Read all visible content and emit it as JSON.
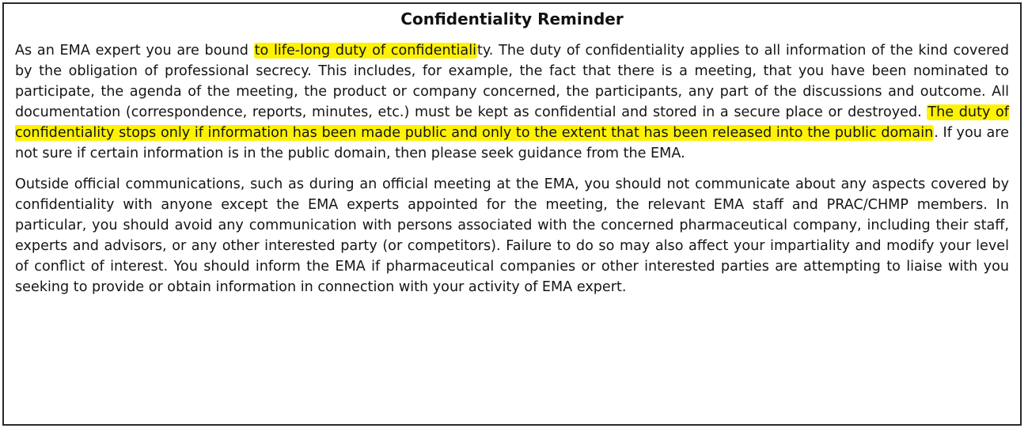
{
  "document": {
    "title": "Confidentiality Reminder",
    "paragraph1": {
      "s1_pre": "As an EMA expert you are bound ",
      "s1_highlight": "to life-long duty of confidentiali",
      "s1_post": "ty. The duty of confidentiality applies to all information of the kind covered by the obligation of professional secrecy. This includes, for example, the fact that there is a meeting, that you have been nominated to participate, the agenda of the meeting, the product or company concerned, the participants, any part of the discussions and outcome. All documentation (correspondence, reports, minutes, etc.) must be kept as confidential and stored in a secure place or destroyed. ",
      "s2_highlight": "The duty of confidentiality stops only if information has been made public and only to the extent that has been released into the public domain",
      "s2_post": ". If you are not sure if certain information is in the public domain, then please seek guidance from the EMA."
    },
    "paragraph2": "Outside official communications, such as during an official meeting at the EMA, you should not communicate about any aspects covered by confidentiality with anyone except the EMA experts appointed for the meeting, the relevant EMA staff and PRAC/CHMP members. In particular, you should avoid any communication with persons associated with the concerned pharmaceutical company, including their staff, experts and advisors, or any other interested party (or competitors). Failure to do so may also affect your impartiality and modify your level of conflict of interest. You should inform the EMA if pharmaceutical companies or other interested parties are attempting to liaise with you seeking to provide or obtain information in connection with your activity of EMA expert.",
    "highlight_color": "#fff200",
    "border_color": "#2a2a2a"
  }
}
